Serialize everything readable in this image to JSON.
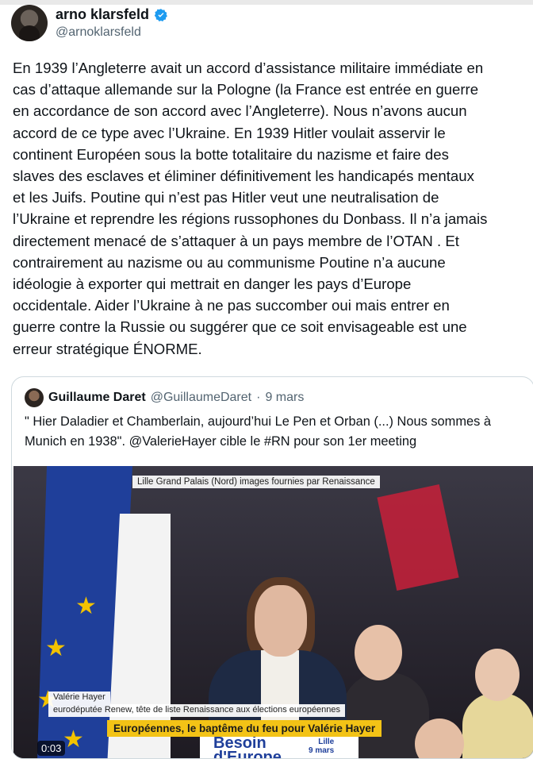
{
  "author": {
    "display_name": "arno klarsfeld",
    "handle": "@arnoklarsfeld",
    "verified_icon": "verified-badge-icon",
    "verified_color": "#1d9bf0"
  },
  "tweet": {
    "text": "En 1939 l’Angleterre avait un accord d’assistance militaire immédiate en\ncas d’attaque allemande sur la Pologne (la France est entrée en guerre\nen accordance de son accord avec l’Angleterre). Nous n’avons aucun\naccord de ce type avec l’Ukraine. En 1939 Hitler voulait asservir le\ncontinent Européen sous la botte totalitaire du nazisme et faire des\nslaves des esclaves et éliminer définitivement les handicapés mentaux\net les Juifs. Poutine qui n’est pas Hitler veut une neutralisation de\nl’Ukraine et reprendre les régions russophones du Donbass. Il n’a jamais\ndirectement menacé  de s’attaquer à un pays membre de l’OTAN . Et\ncontrairement au nazisme ou au communisme Poutine n’a aucune\nidéologie à exporter qui mettrait en danger les pays d’Europe\noccidentale. Aider l’Ukraine à ne pas succomber oui mais entrer en\nguerre contre la Russie ou suggérer que ce soit envisageable est une\nerreur stratégique ÉNORME."
  },
  "quoted": {
    "display_name": "Guillaume Daret",
    "handle": "@GuillaumeDaret",
    "separator": "·",
    "date": "9 mars",
    "text": "\" Hier Daladier et Chamberlain, aujourd’hui Le Pen et Orban (...) Nous sommes à Munich en 1938\". @ValerieHayer cible le #RN pour son 1er meeting",
    "video": {
      "caption_top": "Lille Grand Palais (Nord) images fournies par Renaissance",
      "podium_line1": "Besoin",
      "podium_line2": "d'Europe",
      "podium_city": "Lille",
      "podium_date": "9 mars",
      "lower_name": "Valérie Hayer",
      "lower_subtitle": "eurodéputée Renew, tête de liste Renaissance aux élections européennes",
      "headline": "Européennes, le baptême du feu pour Valérie Hayer",
      "timestamp": "0:03",
      "headline_color": "#f3c316"
    }
  }
}
